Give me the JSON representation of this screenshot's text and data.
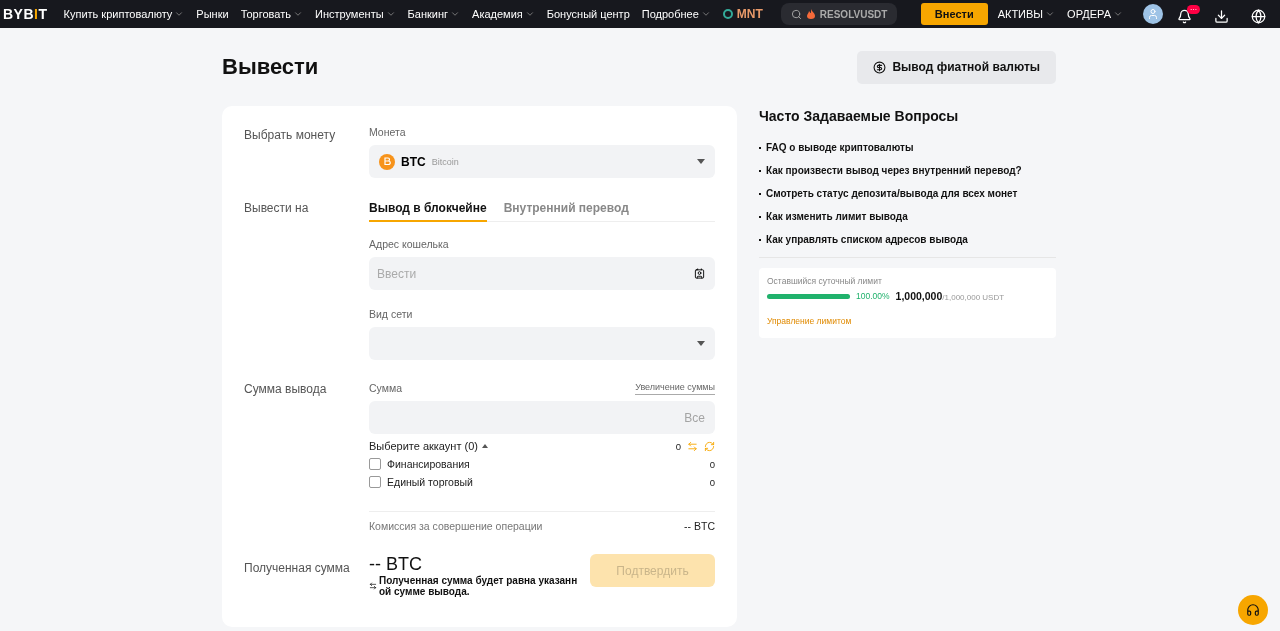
{
  "nav": {
    "logo": [
      {
        "text": "BYB",
        "accent": false
      },
      {
        "text": "I",
        "accent": true
      },
      {
        "text": "T",
        "accent": false
      }
    ],
    "items": [
      {
        "label": "Купить криптовалюту",
        "dropdown": true
      },
      {
        "label": "Рынки",
        "dropdown": false
      },
      {
        "label": "Торговать",
        "dropdown": true
      },
      {
        "label": "Инструменты",
        "dropdown": true
      },
      {
        "label": "Банкинг",
        "dropdown": true
      },
      {
        "label": "Академия",
        "dropdown": true
      },
      {
        "label": "Бонусный центр",
        "dropdown": false
      },
      {
        "label": "Подробнее",
        "dropdown": true
      }
    ],
    "token": "MNT",
    "search": {
      "placeholder": "RESOLVUSDT"
    },
    "deposit": "Внести",
    "right_items": [
      {
        "label": "АКТИВЫ",
        "dropdown": true
      },
      {
        "label": "ОРДЕРА",
        "dropdown": true
      }
    ],
    "notification_badge": "···"
  },
  "page": {
    "title": "Вывести",
    "fiat_button": "Вывод фиатной валюты"
  },
  "form": {
    "coin_section": "Выбрать монету",
    "coin_label": "Монета",
    "coin": {
      "symbol": "BTC",
      "name": "Bitcoin"
    },
    "to_section": "Вывести на",
    "tabs": [
      {
        "label": "Вывод в блокчейне",
        "selected": true
      },
      {
        "label": "Внутренний перевод",
        "selected": false
      }
    ],
    "address_label": "Адрес кошелька",
    "address_placeholder": "Ввести",
    "network_label": "Вид сети",
    "amount_section": "Сумма вывода",
    "amount_label": "Сумма",
    "increase_link": "Увеличение суммы",
    "all_button": "Все",
    "account_select": "Выберите аккаунт (0)",
    "account_total": "0",
    "accounts": [
      {
        "label": "Финансирования",
        "value": "0",
        "checked": false
      },
      {
        "label": "Единый торговый",
        "value": "0",
        "checked": false
      }
    ],
    "fee_label": "Комиссия за совершение операции",
    "fee_value": "-- BTC",
    "received_section": "Полученная сумма",
    "received_value": "-- BTC",
    "received_note": "Полученная сумма будет равна указанн ой сумме вывода.",
    "confirm": {
      "label": "Подтвердить",
      "disabled": true
    }
  },
  "faq": {
    "title": "Часто Задаваемые Вопросы",
    "items": [
      "FAQ о выводе криптовалюты",
      "Как произвести вывод через внутренний перевод?",
      "Смотреть статус депозита/вывода для всех монет",
      "Как изменить лимит вывода",
      "Как управлять списком адресов вывода"
    ]
  },
  "limit": {
    "label": "Оставшийся суточный лимит",
    "level": 1,
    "percent": "100.00%",
    "remaining": "1,000,000",
    "total": "/1,000,000 USDT",
    "manage_link": "Управление лимитом"
  }
}
